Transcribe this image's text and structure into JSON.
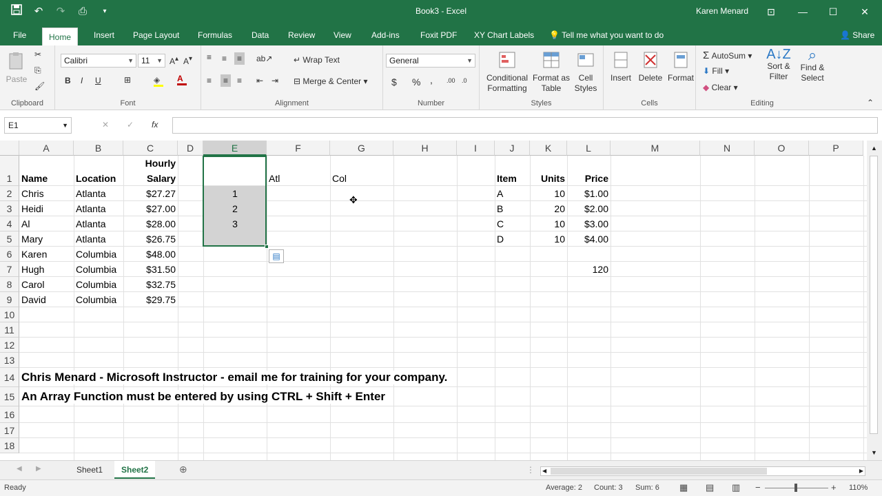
{
  "window": {
    "title": "Book3 - Excel",
    "user": "Karen Menard",
    "qat_icons": [
      "save-icon",
      "undo-icon",
      "redo-icon",
      "print-preview-icon",
      "customize-icon"
    ]
  },
  "tabs": [
    "File",
    "Home",
    "Insert",
    "Page Layout",
    "Formulas",
    "Data",
    "Review",
    "View",
    "Add-ins",
    "Foxit PDF",
    "XY Chart Labels"
  ],
  "active_tab": "Home",
  "tell_me": "Tell me what you want to do",
  "share": "Share",
  "ribbon": {
    "clipboard": {
      "label": "Clipboard",
      "paste": "Paste"
    },
    "font": {
      "label": "Font",
      "name": "Calibri",
      "size": "11",
      "bold": "B",
      "italic": "I",
      "underline": "U"
    },
    "alignment": {
      "label": "Alignment",
      "wrap": "Wrap Text",
      "merge": "Merge & Center"
    },
    "number": {
      "label": "Number",
      "format": "General",
      "currency": "$",
      "percent": "%",
      "comma": ","
    },
    "styles": {
      "label": "Styles",
      "conditional": "Conditional Formatting",
      "format_table": "Format as Table",
      "cell_styles": "Cell Styles"
    },
    "cells": {
      "label": "Cells",
      "insert": "Insert",
      "delete": "Delete",
      "format": "Format"
    },
    "editing": {
      "label": "Editing",
      "autosum": "AutoSum",
      "fill": "Fill",
      "clear": "Clear",
      "sort": "Sort & Filter",
      "find": "Find & Select"
    }
  },
  "namebox": "E1",
  "fx": "fx",
  "columns": [
    "A",
    "B",
    "C",
    "D",
    "E",
    "F",
    "G",
    "H",
    "I",
    "J",
    "K",
    "L",
    "M",
    "N",
    "O",
    "P"
  ],
  "rows": [
    "1",
    "2",
    "3",
    "4",
    "5",
    "6",
    "7",
    "8",
    "9",
    "10",
    "11",
    "12",
    "13",
    "14",
    "15",
    "16",
    "17",
    "18"
  ],
  "cells": {
    "C1a": "Hourly",
    "A1": "Name",
    "B1": "Location",
    "C1": "Salary",
    "F1": "Atl",
    "G1": "Col",
    "A2": "Chris",
    "B2": "Atlanta",
    "C2": "$27.27",
    "A3": "Heidi",
    "B3": "Atlanta",
    "C3": "$27.00",
    "A4": "Al",
    "B4": "Atlanta",
    "C4": "$28.00",
    "A5": "Mary",
    "B5": "Atlanta",
    "C5": "$26.75",
    "A6": "Karen",
    "B6": "Columbia",
    "C6": "$48.00",
    "A7": "Hugh",
    "B7": "Columbia",
    "C7": "$31.50",
    "A8": "Carol",
    "B8": "Columbia",
    "C8": "$32.75",
    "A9": "David",
    "B9": "Columbia",
    "C9": "$29.75",
    "E2": "1",
    "E3": "2",
    "E4": "3",
    "J1": "Item",
    "K1": "Units",
    "L1": "Price",
    "J2": "A",
    "K2": "10",
    "L2": "$1.00",
    "J3": "B",
    "K3": "20",
    "L3": "$2.00",
    "J4": "C",
    "K4": "10",
    "L4": "$3.00",
    "J5": "D",
    "K5": "10",
    "L5": "$4.00",
    "L7": "120",
    "A14": "Chris Menard - Microsoft Instructor - email me for training for your company.",
    "A15": "An Array Function must be entered by using CTRL + Shift + Enter"
  },
  "sheets": [
    "Sheet1",
    "Sheet2"
  ],
  "active_sheet": "Sheet2",
  "status": {
    "ready": "Ready",
    "average": "Average: 2",
    "count": "Count: 3",
    "sum": "Sum: 6",
    "zoom": "110%"
  },
  "colors": {
    "accent": "#217346",
    "selection": "#d3d3d3"
  }
}
